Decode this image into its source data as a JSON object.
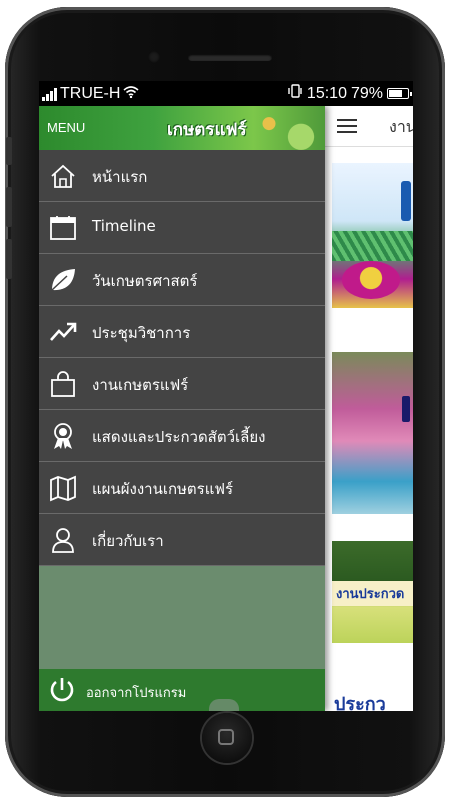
{
  "status_bar": {
    "carrier": "TRUE-H",
    "time": "15:10",
    "battery_percent": "79%",
    "battery_level": 0.79
  },
  "drawer": {
    "menu_label": "MENU",
    "brand": "เกษตรแฟร์",
    "items": [
      {
        "label": "หน้าแรก",
        "icon": "home-icon"
      },
      {
        "label": "Timeline",
        "icon": "calendar-icon"
      },
      {
        "label": "วันเกษตรศาสตร์",
        "icon": "leaf-icon"
      },
      {
        "label": "ประชุมวิชาการ",
        "icon": "trend-arrow-icon"
      },
      {
        "label": "งานเกษตรแฟร์",
        "icon": "shopping-bag-icon"
      },
      {
        "label": "แสดงและประกวดสัตว์เลี้ยง",
        "icon": "award-ribbon-icon"
      },
      {
        "label": "แผนผังงานเกษตรแฟร์",
        "icon": "map-icon"
      },
      {
        "label": "เกี่ยวกับเรา",
        "icon": "person-icon"
      }
    ],
    "footer_label": "ออกจากโปรแกรม"
  },
  "main": {
    "title": "งาน",
    "thumb3_label": "งานประกวด",
    "thumb4_label": "ประกว"
  },
  "colors": {
    "drawer_item_bg": "#444444",
    "drawer_bg": "#6b8c6e",
    "header_green": "#3fa23f",
    "footer_green": "#2e7a2e"
  }
}
